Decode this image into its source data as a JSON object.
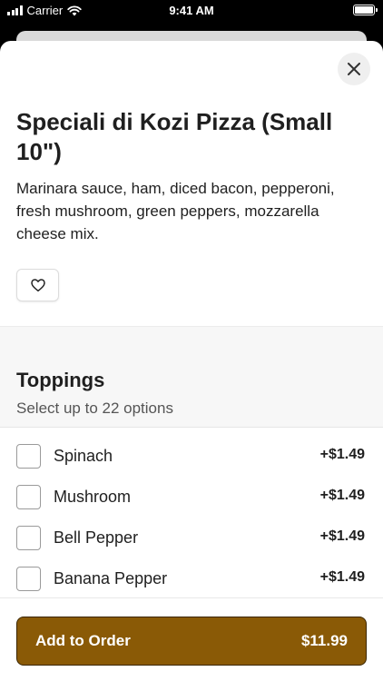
{
  "status_bar": {
    "carrier": "Carrier",
    "time": "9:41 AM"
  },
  "item": {
    "title": "Speciali di Kozi Pizza (Small 10\")",
    "description": "Marinara sauce, ham, diced bacon, pepperoni, fresh mushroom, green peppers, mozzarella cheese mix."
  },
  "section": {
    "title": "Toppings",
    "subtitle": "Select up to 22 options"
  },
  "options": [
    {
      "label": "Spinach",
      "price": "+$1.49"
    },
    {
      "label": "Mushroom",
      "price": "+$1.49"
    },
    {
      "label": "Bell Pepper",
      "price": "+$1.49"
    },
    {
      "label": "Banana Pepper",
      "price": "+$1.49"
    }
  ],
  "footer": {
    "add_label": "Add to Order",
    "total": "$11.99"
  },
  "colors": {
    "accent": "#8a5a06",
    "sheet_bg": "#ffffff",
    "section_bg": "#f7f7f7"
  },
  "icons": {
    "close": "close-icon",
    "favorite": "heart-icon",
    "signal": "signal-icon",
    "wifi": "wifi-icon",
    "battery": "battery-icon"
  }
}
